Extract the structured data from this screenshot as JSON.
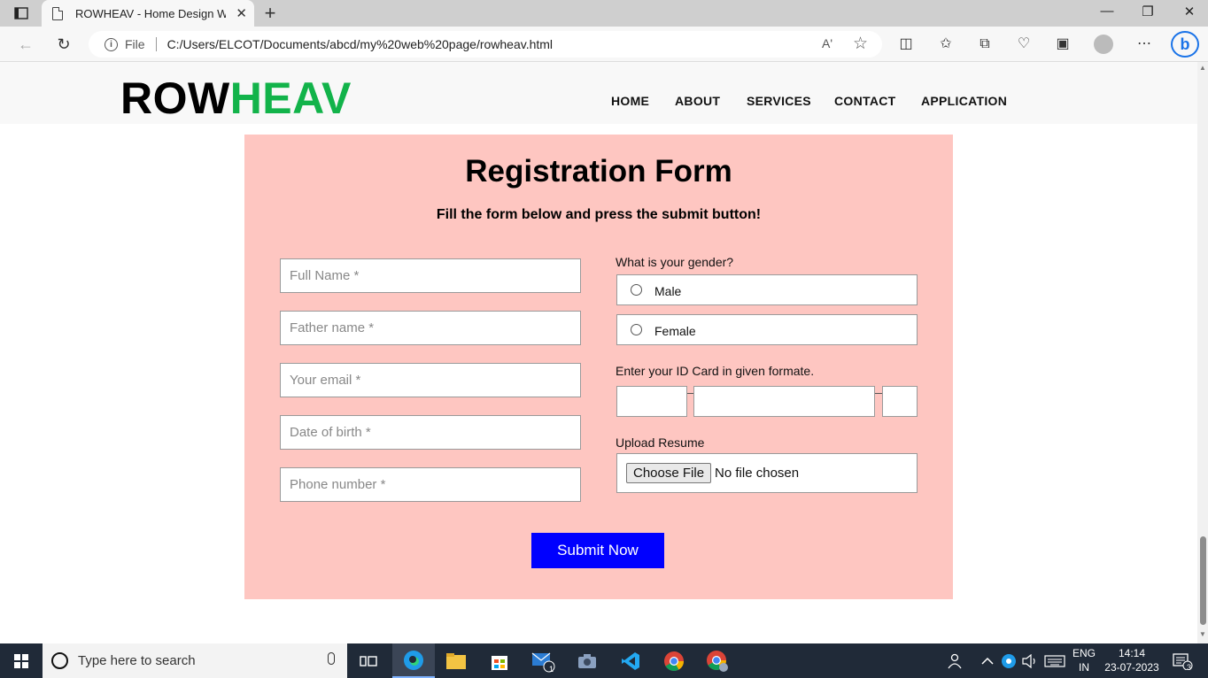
{
  "browser": {
    "tab_title": "ROWHEAV - Home Design Website",
    "url_prefix": "File",
    "url": "C:/Users/ELCOT/Documents/abcd/my%20web%20page/rowheav.html",
    "read_aloud": "Aʹ"
  },
  "site": {
    "logo_part1": "ROW",
    "logo_part2": "HEAV",
    "logo_part2_color": "#12b34a",
    "nav": [
      "HOME",
      "ABOUT",
      "SERVICES",
      "CONTACT",
      "APPLICATION"
    ]
  },
  "form": {
    "title": "Registration Form",
    "subtitle": "Fill the form below and press the submit button!",
    "background_color": "#fec6c1",
    "fields": [
      {
        "placeholder": "Full Name *"
      },
      {
        "placeholder": "Father name *"
      },
      {
        "placeholder": "Your email *"
      },
      {
        "placeholder": "Date of birth *"
      },
      {
        "placeholder": "Phone number *"
      }
    ],
    "gender_label": "What is your gender?",
    "gender_options": [
      "Male",
      "Female"
    ],
    "id_label": "Enter your ID Card in given formate.",
    "upload_label": "Upload Resume",
    "choose_file": "Choose File",
    "no_file": "No file chosen",
    "submit": "Submit Now",
    "submit_color": "#0000ff"
  },
  "taskbar": {
    "search_placeholder": "Type here to search",
    "lang_line1": "ENG",
    "lang_line2": "IN",
    "time": "14:14",
    "date": "23-07-2023",
    "mail_badge": "1",
    "notification_count": "3"
  }
}
